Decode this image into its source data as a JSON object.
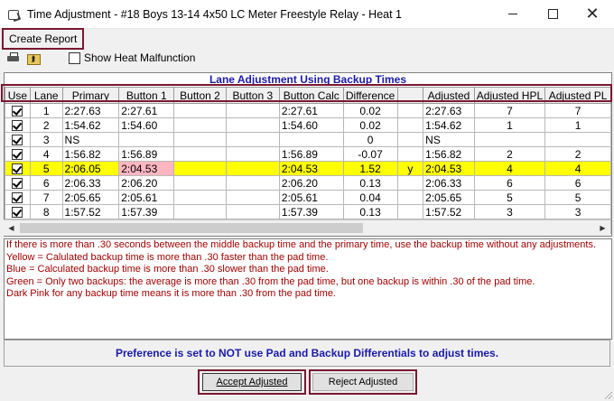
{
  "window": {
    "title": "Time Adjustment - #18 Boys 13-14 4x50 LC Meter Freestyle Relay - Heat 1",
    "minimize_glyph": "—",
    "close_glyph": "✕"
  },
  "menu": {
    "create_report": "Create Report"
  },
  "toolbar": {
    "show_heat_malfunction": "Show Heat Malfunction",
    "show_heat_malfunction_checked": false
  },
  "grid": {
    "title": "Lane Adjustment Using Backup Times",
    "columns": [
      "Use",
      "Lane",
      "Primary",
      "Button 1",
      "Button 2",
      "Button 3",
      "Button Calc",
      "Difference",
      "",
      "Adjusted",
      "Adjusted HPL",
      "Adjusted PL"
    ],
    "rows": [
      [
        "",
        "1",
        "2:27.63",
        "2:27.61",
        "",
        "",
        "2:27.61",
        "0.02",
        "",
        "2:27.63",
        "7",
        "7"
      ],
      [
        "",
        "2",
        "1:54.62",
        "1:54.60",
        "",
        "",
        "1:54.60",
        "0.02",
        "",
        "1:54.62",
        "1",
        "1"
      ],
      [
        "",
        "3",
        "NS",
        "",
        "",
        "",
        "",
        "0",
        "",
        "NS",
        "",
        ""
      ],
      [
        "",
        "4",
        "1:56.82",
        "1:56.89",
        "",
        "",
        "1:56.89",
        "-0.07",
        "",
        "1:56.82",
        "2",
        "2"
      ],
      [
        "",
        "5",
        "2:06.05",
        "2:04.53",
        "",
        "",
        "2:04.53",
        "1.52",
        "y",
        "2:04.53",
        "4",
        "4"
      ],
      [
        "",
        "6",
        "2:06.33",
        "2:06.20",
        "",
        "",
        "2:06.20",
        "0.13",
        "",
        "2:06.33",
        "6",
        "6"
      ],
      [
        "",
        "7",
        "2:05.65",
        "2:05.61",
        "",
        "",
        "2:05.61",
        "0.04",
        "",
        "2:05.65",
        "5",
        "5"
      ],
      [
        "",
        "8",
        "1:57.52",
        "1:57.39",
        "",
        "",
        "1:57.39",
        "0.13",
        "",
        "1:57.52",
        "3",
        "3"
      ],
      [
        "",
        "",
        "",
        "",
        "",
        "",
        "",
        "",
        "",
        "",
        "",
        ""
      ]
    ],
    "highlight_row": 4,
    "highlight_color": "#ffff00",
    "pink_color": "#ffb6c1"
  },
  "notes": [
    "If there is more than .30 seconds between the middle backup time and the primary time, use the backup time without any adjustments.",
    "Yellow = Calulated backup time is more than .30 faster than the pad time.",
    "Blue = Calculated backup time is more than .30 slower than the pad time.",
    "Green = Only two backups: the average is more than .30 from the pad time, but one backup is within .30 of the pad time.",
    "Dark Pink for any backup time means it is more than .30 from the pad time."
  ],
  "preference_text": "Preference is set to NOT use Pad and Backup Differentials to adjust times.",
  "buttons": {
    "accept": "Accept Adjusted",
    "reject": "Reject  Adjusted"
  },
  "colors": {
    "outline": "#7a1830",
    "grid_title": "#1a1aa8",
    "notes_text": "#a00000"
  }
}
